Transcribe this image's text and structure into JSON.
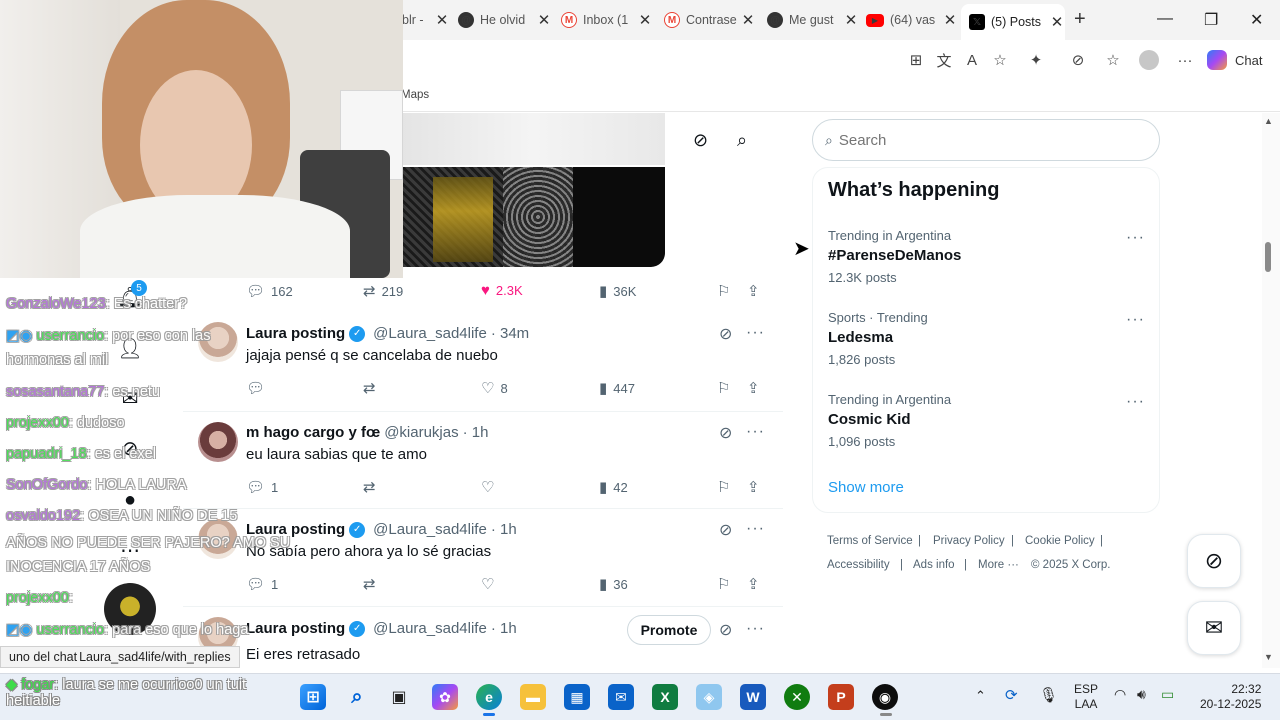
{
  "browser": {
    "tabs": [
      {
        "title": "blr -",
        "icon": "tumblr-icon",
        "color": "#36465d"
      },
      {
        "title": "He olvid",
        "icon": "threads-icon",
        "color": "#333333"
      },
      {
        "title": "Inbox (1",
        "icon": "gmail-icon",
        "color": "#ea4335"
      },
      {
        "title": "Contrase",
        "icon": "gmail-icon",
        "color": "#ea4335"
      },
      {
        "title": "Me gust",
        "icon": "threads-icon",
        "color": "#333333"
      },
      {
        "title": "(64) vas",
        "icon": "youtube-icon",
        "color": "#ff0000"
      },
      {
        "title": "(5) Posts",
        "icon": "x-icon",
        "color": "#000000"
      }
    ],
    "copilot_label": "Chat",
    "favorites": {
      "maps": "Maps"
    },
    "status_url": "Laura_sad4life/with_replies"
  },
  "first_post_actions": {
    "replies": "162",
    "reposts": "219",
    "likes": "2.3K",
    "views": "36K"
  },
  "posts": [
    {
      "name": "Laura posting",
      "verified": true,
      "handle": "@Laura_sad4life",
      "time": "· 34m",
      "text": "jajaja pensé q se cancelaba de nuebo",
      "replies": "",
      "reposts": "",
      "likes": "8",
      "views": "447"
    },
    {
      "name": "m hago cargo y fœ",
      "verified": false,
      "handle": "@kiarukjas",
      "time": "· 1h",
      "text": "eu laura sabias que te amo",
      "replies": "1",
      "reposts": "",
      "likes": "",
      "views": "42"
    },
    {
      "name": "Laura posting",
      "verified": true,
      "handle": "@Laura_sad4life",
      "time": "· 1h",
      "text": "No sabía pero ahora ya lo sé gracias",
      "replies": "1",
      "reposts": "",
      "likes": "",
      "views": "36"
    },
    {
      "name": "Laura posting",
      "verified": true,
      "handle": "@Laura_sad4life",
      "time": "· 1h",
      "text": "Ei eres retrasado",
      "promote_label": "Promote"
    }
  ],
  "sidebar": {
    "search_placeholder": "Search",
    "trends_title": "What’s happening",
    "trends": [
      {
        "context": "Trending in Argentina",
        "name": "#ParenseDeManos",
        "count": "12.3K posts"
      },
      {
        "context": "Sports · Trending",
        "name": "Ledesma",
        "count": "1,826 posts"
      },
      {
        "context": "Trending in Argentina",
        "name": "Cosmic Kid",
        "count": "1,096 posts"
      }
    ],
    "show_more": "Show more",
    "footer": [
      "Terms of Service",
      "Privacy Policy",
      "Cookie Policy",
      "Accessibility",
      "Ads info",
      "More ···",
      "© 2025 X Corp."
    ]
  },
  "nav": {
    "notification_badge": "5"
  },
  "stream_chat": [
    {
      "user": "GonzaloWe123",
      "msg": ": Es chatter?",
      "color": "purple"
    },
    {
      "user": "userrancio",
      "msg": ": por eso con las",
      "color": "green"
    },
    {
      "user": "",
      "msg": "hormonas al mil",
      "color": "none"
    },
    {
      "user": "sosasantana77",
      "msg": ": es netu",
      "color": "purple"
    },
    {
      "user": "projexx00",
      "msg": ": dudoso",
      "color": "green"
    },
    {
      "user": "papuadri_18",
      "msg": ": es el exel",
      "color": "green"
    },
    {
      "user": "SonOfGordo",
      "msg": ": HOLA LAURA",
      "color": "purple"
    },
    {
      "user": "osvaldo192",
      "msg": ": OSEA UN NIÑO DE 15",
      "color": "purple"
    },
    {
      "user": "",
      "msg": "AÑOS NO PUEDE SER PAJERO? AMO SU",
      "color": "none"
    },
    {
      "user": "",
      "msg": "INOCENCIA 17 AÑOS",
      "color": "none"
    },
    {
      "user": "projexx00",
      "msg": ":",
      "color": "green"
    },
    {
      "user": "userrancio",
      "msg": ": para eso que lo haga",
      "color": "green"
    },
    {
      "user": "",
      "msg": "uno del chat",
      "color": "none"
    }
  ],
  "chat_bottom": {
    "user": "fogar",
    "msg": ": laura se me ocurrioo0 un tuit",
    "msg2": "heitiable"
  },
  "taskbar": {
    "lang": "ESP",
    "lang2": "LAA",
    "time": "22:32",
    "date": "20-12-2025"
  },
  "colors": {
    "accent": "#1d9bf0",
    "like": "#f91880",
    "text": "#0f1419",
    "muted": "#536471"
  }
}
